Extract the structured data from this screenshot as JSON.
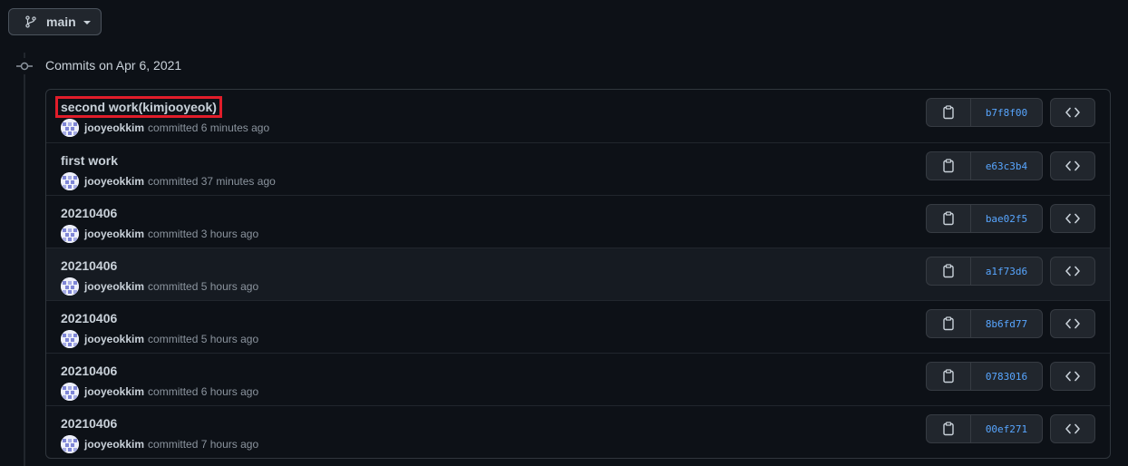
{
  "branch": {
    "label": "main"
  },
  "group": {
    "title": "Commits on Apr 6, 2021"
  },
  "commits": [
    {
      "title": "second work(kimjooyeok)",
      "author": "jooyeokkim",
      "action": "committed",
      "time": "6 minutes ago",
      "sha": "b7f8f00"
    },
    {
      "title": "first work",
      "author": "jooyeokkim",
      "action": "committed",
      "time": "37 minutes ago",
      "sha": "e63c3b4"
    },
    {
      "title": "20210406",
      "author": "jooyeokkim",
      "action": "committed",
      "time": "3 hours ago",
      "sha": "bae02f5"
    },
    {
      "title": "20210406",
      "author": "jooyeokkim",
      "action": "committed",
      "time": "5 hours ago",
      "sha": "a1f73d6"
    },
    {
      "title": "20210406",
      "author": "jooyeokkim",
      "action": "committed",
      "time": "5 hours ago",
      "sha": "8b6fd77"
    },
    {
      "title": "20210406",
      "author": "jooyeokkim",
      "action": "committed",
      "time": "6 hours ago",
      "sha": "0783016"
    },
    {
      "title": "20210406",
      "author": "jooyeokkim",
      "action": "committed",
      "time": "7 hours ago",
      "sha": "00ef271"
    }
  ],
  "icons": {
    "branch": "git-branch-icon",
    "copy": "clipboard-icon",
    "browse": "code-icon",
    "timeline": "git-commit-icon"
  },
  "colors": {
    "background": "#0d1117",
    "sha_link": "#58a6ff",
    "highlight_box": "#e11d2a"
  }
}
